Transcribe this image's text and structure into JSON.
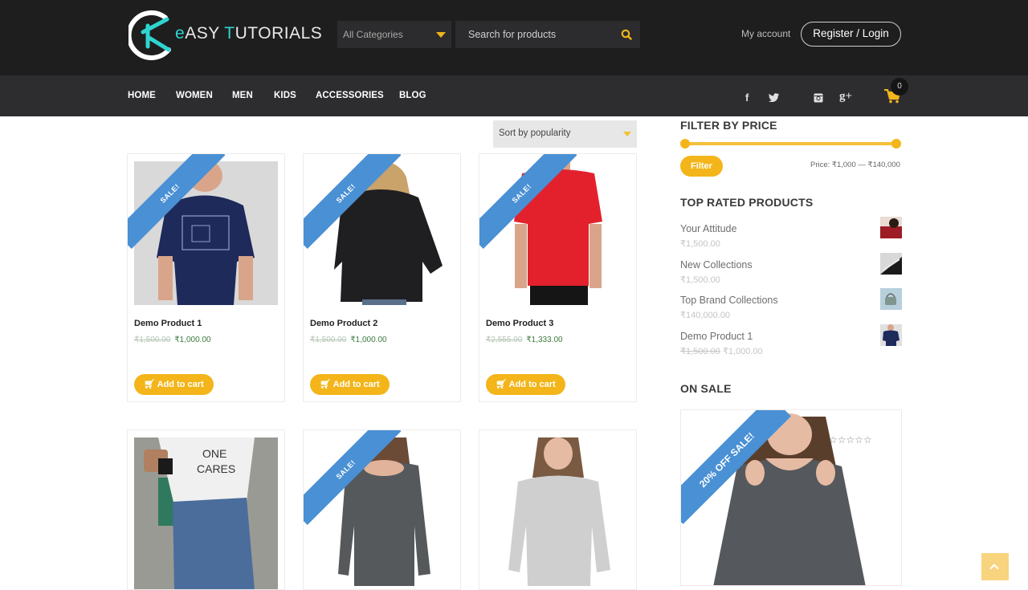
{
  "brand": {
    "logo_prefix": "e",
    "logo_word1": "ASY ",
    "logo_t": "T",
    "logo_word2": "UTORIALS",
    "accent_color": "#2fd4d0"
  },
  "header": {
    "category_select": "All Categories",
    "search_placeholder": "Search for products",
    "my_account": "My account",
    "register_login": "Register / Login"
  },
  "nav": {
    "items": [
      "HOME",
      "WOMEN",
      "MEN",
      "KIDS",
      "ACCESSORIES",
      "BLOG"
    ],
    "social": [
      "facebook",
      "twitter",
      "instagram",
      "google-plus"
    ],
    "cart_count": "0"
  },
  "shop": {
    "sort_select": "Sort by popularity",
    "products": [
      {
        "name": "Demo Product 1",
        "old_price": "₹1,500.00",
        "price": "₹1,000.00",
        "badge": "SALE!",
        "button": "Add to cart"
      },
      {
        "name": "Demo Product 2",
        "old_price": "₹1,500.00",
        "price": "₹1,000.00",
        "badge": "SALE!",
        "button": "Add to cart"
      },
      {
        "name": "Demo Product 3",
        "old_price": "₹2,555.00",
        "price": "₹1,333.00",
        "badge": "SALE!",
        "button": "Add to cart"
      },
      {
        "name": "",
        "badge": ""
      },
      {
        "name": "",
        "badge": "SALE!"
      },
      {
        "name": "",
        "badge": ""
      }
    ]
  },
  "sidebar": {
    "filter": {
      "title": "FILTER BY PRICE",
      "button": "Filter",
      "range_label": "Price: ₹1,000 — ₹140,000",
      "min_fraction": 0.0,
      "max_fraction": 1.0
    },
    "top_rated": {
      "title": "TOP RATED PRODUCTS",
      "items": [
        {
          "name": "Your Attitude",
          "price": "₹1,500.00"
        },
        {
          "name": "New Collections",
          "price": "₹1,500.00"
        },
        {
          "name": "Top Brand Collections",
          "price": "₹140,000.00"
        },
        {
          "name": "Demo Product 1",
          "old_price": "₹1,500.00",
          "price": "₹1,000.00"
        }
      ]
    },
    "on_sale": {
      "title": "ON SALE",
      "badge": "20% OFF SALE!",
      "rating": "☆☆☆☆☆"
    }
  },
  "colors": {
    "accent_yellow": "#f3b51a",
    "ribbon_blue": "#4a90d4",
    "topbar": "#1e1e1f",
    "navbar": "#2d2d30"
  }
}
